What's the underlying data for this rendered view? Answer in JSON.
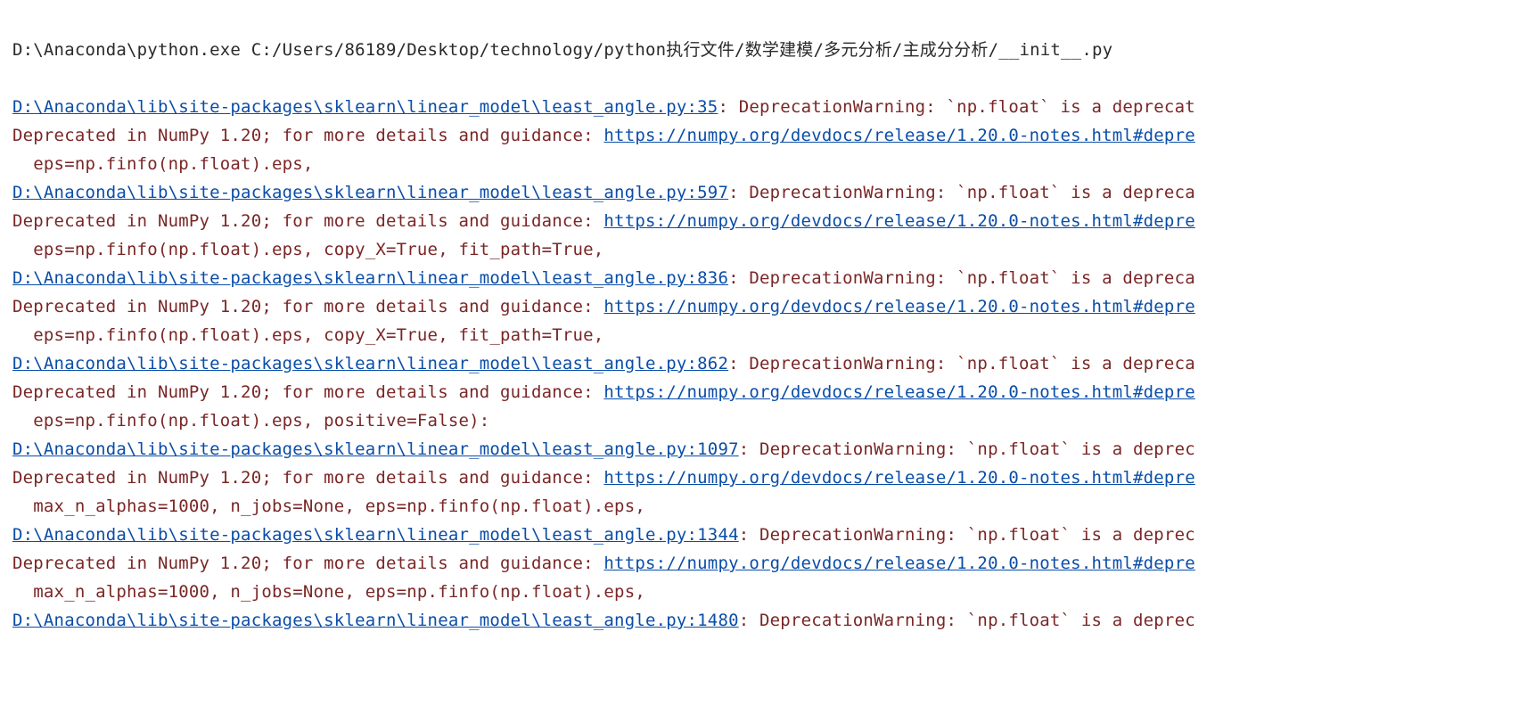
{
  "command_line": "D:\\Anaconda\\python.exe C:/Users/86189/Desktop/technology/python执行文件/数学建模/多元分析/主成分分析/__init__.py",
  "guidance_prefix": "Deprecated in NumPy 1.20; for more details and guidance: ",
  "guidance_url": "https://numpy.org/devdocs/release/1.20.0-notes.html#depre",
  "warnings": [
    {
      "file_link": "D:\\Anaconda\\lib\\site-packages\\sklearn\\linear_model\\least_angle.py:35",
      "tail": ": DeprecationWarning: `np.float` is a deprecat",
      "code": "  eps=np.finfo(np.float).eps,"
    },
    {
      "file_link": "D:\\Anaconda\\lib\\site-packages\\sklearn\\linear_model\\least_angle.py:597",
      "tail": ": DeprecationWarning: `np.float` is a depreca",
      "code": "  eps=np.finfo(np.float).eps, copy_X=True, fit_path=True,"
    },
    {
      "file_link": "D:\\Anaconda\\lib\\site-packages\\sklearn\\linear_model\\least_angle.py:836",
      "tail": ": DeprecationWarning: `np.float` is a depreca",
      "code": "  eps=np.finfo(np.float).eps, copy_X=True, fit_path=True,"
    },
    {
      "file_link": "D:\\Anaconda\\lib\\site-packages\\sklearn\\linear_model\\least_angle.py:862",
      "tail": ": DeprecationWarning: `np.float` is a depreca",
      "code": "  eps=np.finfo(np.float).eps, positive=False):"
    },
    {
      "file_link": "D:\\Anaconda\\lib\\site-packages\\sklearn\\linear_model\\least_angle.py:1097",
      "tail": ": DeprecationWarning: `np.float` is a deprec",
      "code": "  max_n_alphas=1000, n_jobs=None, eps=np.finfo(np.float).eps,"
    },
    {
      "file_link": "D:\\Anaconda\\lib\\site-packages\\sklearn\\linear_model\\least_angle.py:1344",
      "tail": ": DeprecationWarning: `np.float` is a deprec",
      "code": "  max_n_alphas=1000, n_jobs=None, eps=np.finfo(np.float).eps,"
    },
    {
      "file_link": "D:\\Anaconda\\lib\\site-packages\\sklearn\\linear_model\\least_angle.py:1480",
      "tail": ": DeprecationWarning: `np.float` is a deprec",
      "code": null
    }
  ]
}
